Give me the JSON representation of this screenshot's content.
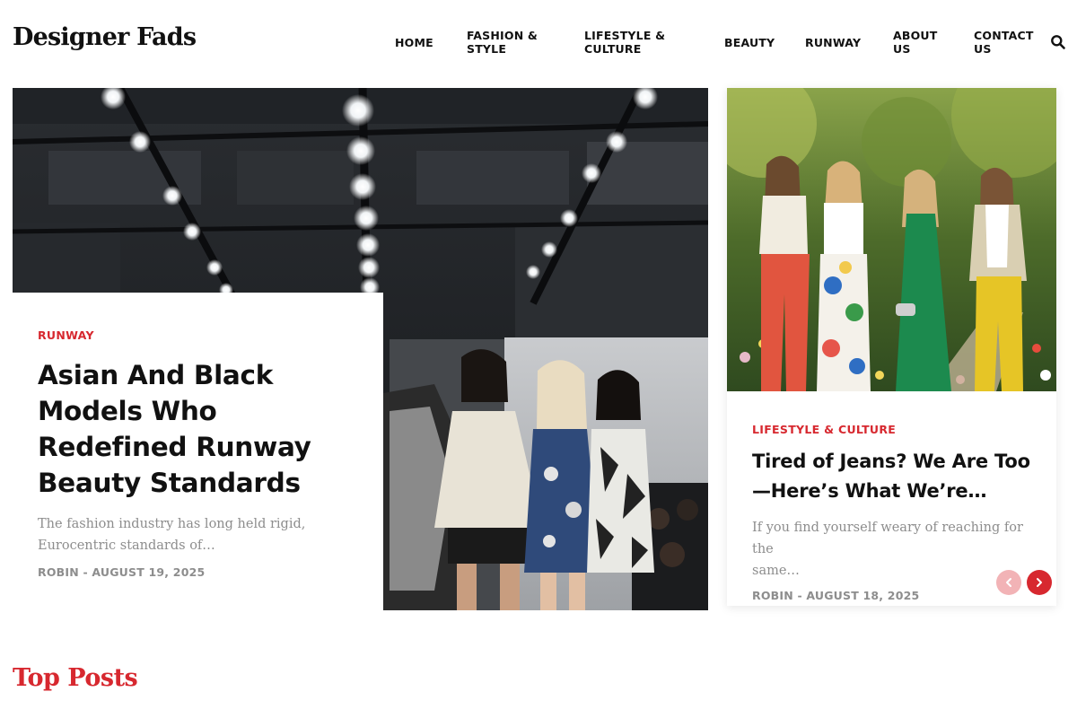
{
  "site": {
    "logo": "Designer Fads"
  },
  "nav": {
    "home": "HOME",
    "fashion_1": "FASHION &",
    "fashion_2": "STYLE",
    "lifestyle_1": "LIFESTYLE &",
    "lifestyle_2": "CULTURE",
    "beauty": "BEAUTY",
    "runway": "RUNWAY",
    "about_1": "ABOUT",
    "about_2": "US",
    "contact_1": "CONTACT",
    "contact_2": "US",
    "search_icon": "search-icon"
  },
  "featured": {
    "category": "RUNWAY",
    "title": "Asian And Black Models Who Redefined Runway Beauty Standards",
    "excerpt_line1": "The fashion industry has long held rigid,",
    "excerpt_line2": "Eurocentric standards of…",
    "meta": "ROBIN - AUGUST 19, 2025"
  },
  "side_post": {
    "category": "LIFESTYLE & CULTURE",
    "title_line1": "Tired of Jeans? We Are Too",
    "title_line2": "—Here’s What We’re…",
    "excerpt_line1": "If you find yourself weary of reaching for the",
    "excerpt_line2": "same…",
    "meta": "ROBIN - AUGUST 18, 2025"
  },
  "slider": {
    "prev_icon": "chevron-left-icon",
    "next_icon": "chevron-right-icon"
  },
  "sections": {
    "top_posts": "Top Posts"
  },
  "colors": {
    "accent": "#d7282f",
    "accent_light": "#f2b3b6",
    "muted_text": "#8d8d8d",
    "text": "#111111"
  }
}
